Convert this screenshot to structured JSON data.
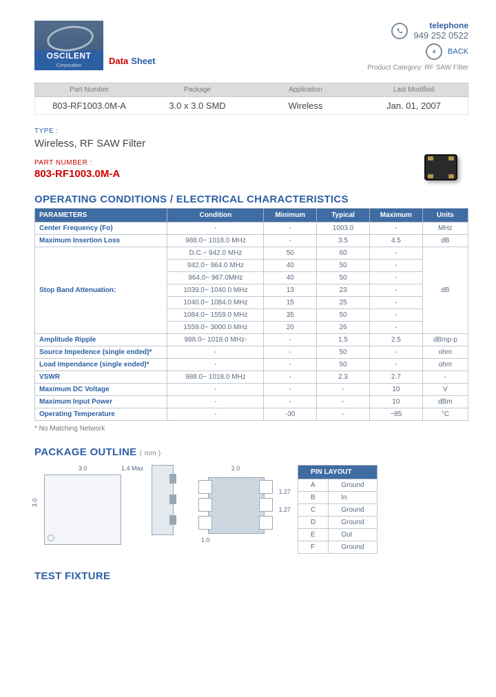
{
  "logo": {
    "brand": "OSCILENT",
    "sub": "Corporation"
  },
  "header": {
    "data_label_red": "Data",
    "data_label_blue": "Sheet",
    "telephone_label": "telephone",
    "telephone_number": "949 252 0522",
    "back_label": "BACK",
    "product_category_label": "Product Category:",
    "product_category_value": "RF SAW Filter"
  },
  "info_bar": {
    "headers": [
      "Part Number",
      "Package",
      "Application",
      "Last Modified"
    ],
    "values": [
      "803-RF1003.0M-A",
      "3.0 x 3.0 SMD",
      "Wireless",
      "Jan. 01, 2007"
    ]
  },
  "type_label": "TYPE :",
  "type_value": "Wireless, RF SAW Filter",
  "pn_label": "PART NUMBER :",
  "pn_value": "803-RF1003.0M-A",
  "sections": {
    "operating": "OPERATING CONDITIONS / ELECTRICAL CHARACTERISTICS",
    "package": "PACKAGE OUTLINE",
    "package_unit": "( mm )",
    "test": "TEST FIXTURE"
  },
  "spec_headers": [
    "PARAMETERS",
    "Condition",
    "Minimum",
    "Typical",
    "Maximum",
    "Units"
  ],
  "spec_rows": [
    {
      "param": "Center Frequency (Fo)",
      "cond": "-",
      "min": "-",
      "typ": "1003.0",
      "max": "-",
      "units": "MHz"
    },
    {
      "param": "Maximum Insertion Loss",
      "cond": "988.0~ 1018.0 MHz",
      "min": "-",
      "typ": "3.5",
      "max": "4.5",
      "units": "dB"
    },
    {
      "param": "Stop Band Attenuation:",
      "cond": "D.C.~ 942.0 MHz",
      "min": "50",
      "typ": "60",
      "max": "-",
      "units": "",
      "rowspan_units": 7,
      "units_val": "dB",
      "rowspan_param": 7
    },
    {
      "param": "",
      "cond": "942.0~ 964.0 MHz",
      "min": "40",
      "typ": "50",
      "max": "-",
      "units": ""
    },
    {
      "param": "",
      "cond": "964.0~ 967.0MHz",
      "min": "40",
      "typ": "50",
      "max": "-",
      "units": ""
    },
    {
      "param": "",
      "cond": "1039.0~ 1040.0 MHz",
      "min": "13",
      "typ": "23",
      "max": "-",
      "units": ""
    },
    {
      "param": "",
      "cond": "1040.0~ 1084.0 MHz",
      "min": "15",
      "typ": "25",
      "max": "-",
      "units": ""
    },
    {
      "param": "",
      "cond": "1084.0~ 1559.0 MHz",
      "min": "35",
      "typ": "50",
      "max": "-",
      "units": ""
    },
    {
      "param": "",
      "cond": "1559.0~ 3000.0 MHz",
      "min": "20",
      "typ": "26",
      "max": "-",
      "units": ""
    },
    {
      "param": "Amplitude Ripple",
      "cond": "988.0~ 1018.0 MHz-",
      "min": "-",
      "typ": "1.5",
      "max": "2.5",
      "units": "dBmp-p"
    },
    {
      "param": "Source Impedence (single ended)*",
      "cond": "-",
      "min": "-",
      "typ": "50",
      "max": "-",
      "units": "ohm"
    },
    {
      "param": "Load Impendance (single ended)*",
      "cond": "-",
      "min": "-",
      "typ": "50",
      "max": "-",
      "units": "ohm"
    },
    {
      "param": "VSWR",
      "cond": "988.0~ 1018.0 MHz",
      "min": "-",
      "typ": "2.3",
      "max": "2.7",
      "units": "-"
    },
    {
      "param": "Maximum DC Voltage",
      "cond": "-",
      "min": "-",
      "typ": "-",
      "max": "10",
      "units": "V"
    },
    {
      "param": "Maximum Input Power",
      "cond": "-",
      "min": "-",
      "typ": "-",
      "max": "10",
      "units": "dBm"
    },
    {
      "param": "Operating Temperature",
      "cond": "-",
      "min": "-30",
      "typ": "-",
      "max": "~85",
      "units": "°C"
    }
  ],
  "footnote": "* No Matching Network",
  "pin_header": "PIN LAYOUT",
  "pin_rows": [
    [
      "A",
      "Ground"
    ],
    [
      "B",
      "In"
    ],
    [
      "C",
      "Ground"
    ],
    [
      "D",
      "Ground"
    ],
    [
      "E",
      "Out"
    ],
    [
      "F",
      "Ground"
    ]
  ],
  "pkg_dims": {
    "w": "3.0",
    "h": "3.0",
    "thick": "1.4 Max",
    "fp_w": "2.0",
    "fp_gap": "1.27",
    "fp_gap2": "1.27",
    "fp_bot": "1.0"
  }
}
